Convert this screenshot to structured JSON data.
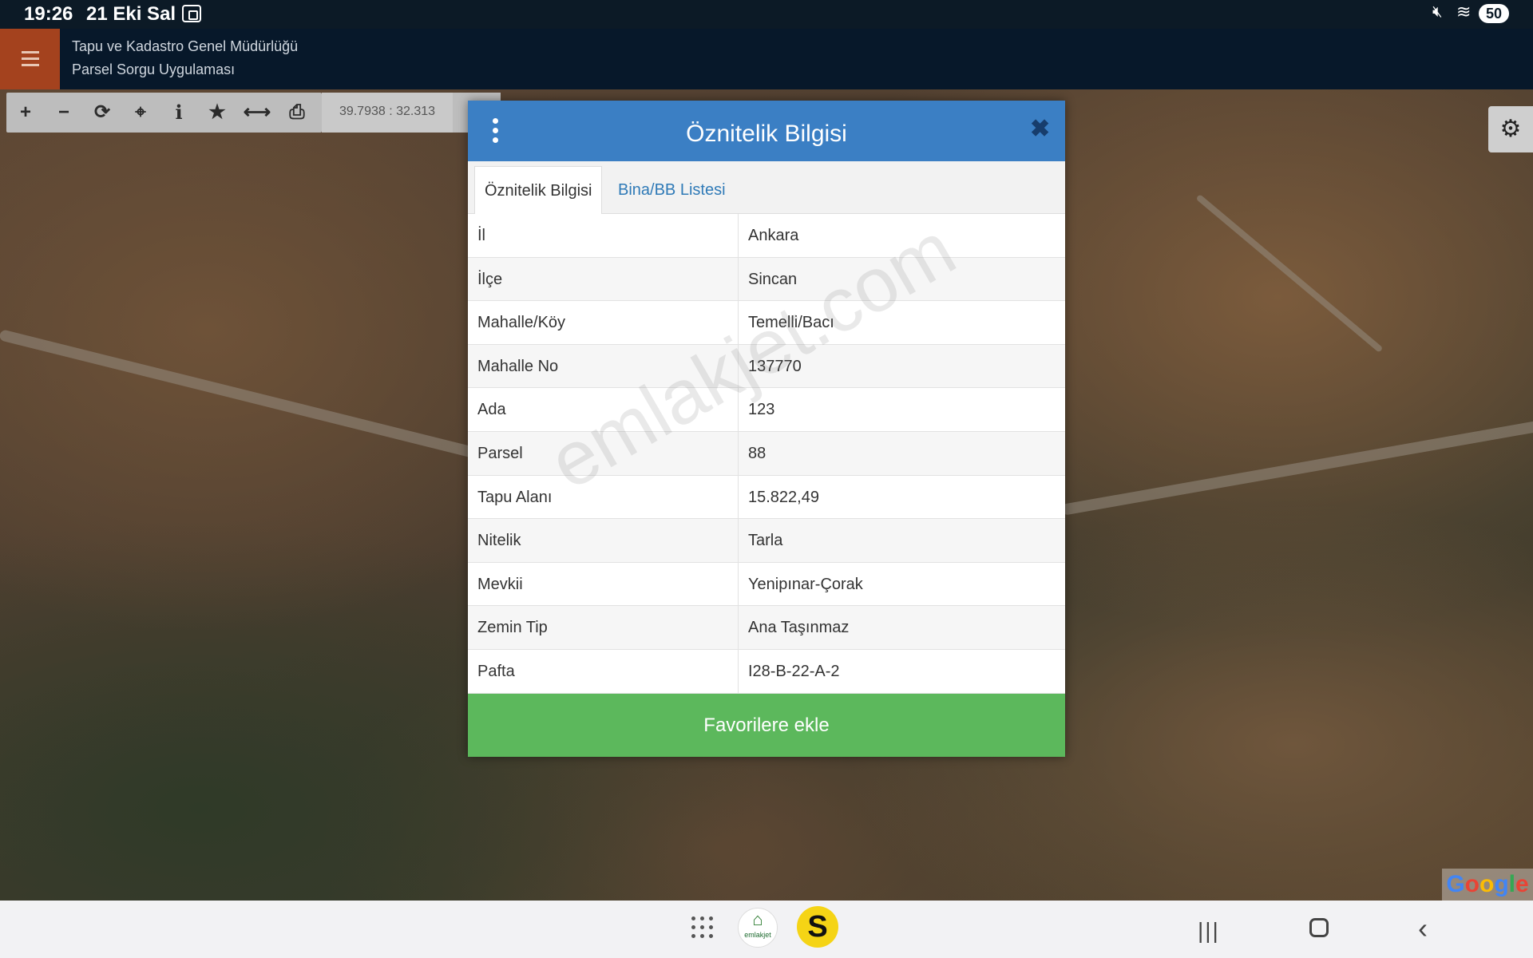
{
  "status_bar": {
    "time": "19:26",
    "date": "21 Eki Sal",
    "battery": "50"
  },
  "app_header": {
    "title_line1": "Tapu ve Kadastro Genel Müdürlüğü",
    "title_line2": "Parsel Sorgu Uygulaması"
  },
  "map_toolbar": {
    "tools": [
      {
        "name": "zoom-in",
        "glyph": "+"
      },
      {
        "name": "zoom-out",
        "glyph": "−"
      },
      {
        "name": "refresh",
        "glyph": "⟳"
      },
      {
        "name": "locate",
        "glyph": "⌖"
      },
      {
        "name": "info",
        "glyph": "i"
      },
      {
        "name": "favorite",
        "glyph": "★"
      },
      {
        "name": "measure",
        "glyph": "⟷"
      },
      {
        "name": "print",
        "glyph": "⎙"
      }
    ],
    "coordinates": "39.7938 : 32.313"
  },
  "modal": {
    "title": "Öznitelik Bilgisi",
    "close_glyph": "✖",
    "tabs": [
      {
        "label": "Öznitelik Bilgisi",
        "active": true
      },
      {
        "label": "Bina/BB Listesi",
        "active": false
      }
    ],
    "rows": [
      {
        "key": "İl",
        "value": "Ankara"
      },
      {
        "key": "İlçe",
        "value": "Sincan"
      },
      {
        "key": "Mahalle/Köy",
        "value": "Temelli/Bacı"
      },
      {
        "key": "Mahalle No",
        "value": "137770"
      },
      {
        "key": "Ada",
        "value": "123"
      },
      {
        "key": "Parsel",
        "value": "88"
      },
      {
        "key": "Tapu Alanı",
        "value": "15.822,49"
      },
      {
        "key": "Nitelik",
        "value": "Tarla"
      },
      {
        "key": "Mevkii",
        "value": "Yenipınar-Çorak"
      },
      {
        "key": "Zemin Tip",
        "value": "Ana Taşınmaz"
      },
      {
        "key": "Pafta",
        "value": "I28-B-22-A-2"
      }
    ],
    "favorite_button": "Favorilere ekle"
  },
  "watermark": "emlakjet.com",
  "map": {
    "attribution_logo": "Google"
  },
  "nav_bar": {
    "emlakjet_label": "emlakjet",
    "s_app_label": "S"
  },
  "colors": {
    "modal_header": "#3b7fc4",
    "favorite_button": "#5cb85c",
    "menu_button": "#a4421e",
    "app_header": "#07182a"
  }
}
